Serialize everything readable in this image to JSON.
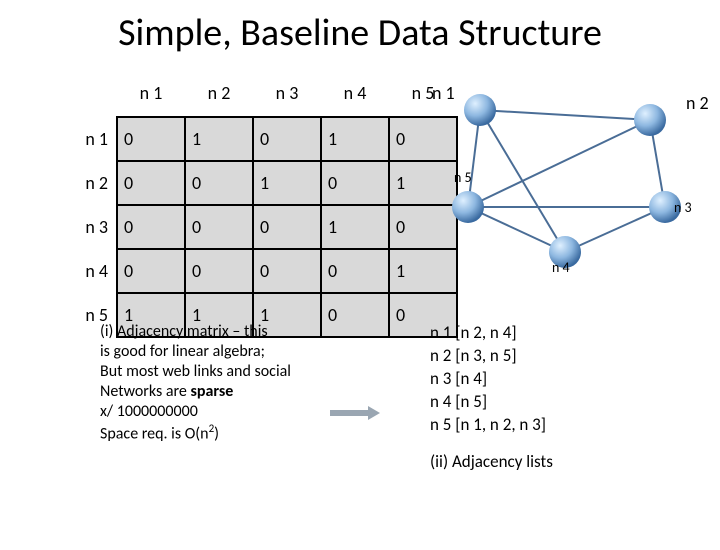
{
  "title": "Simple, Baseline Data Structure",
  "matrix": {
    "cols": [
      "n 1",
      "n 2",
      "n 3",
      "n 4",
      "n 5"
    ],
    "rows": [
      "n 1",
      "n 2",
      "n 3",
      "n 4",
      "n 5"
    ],
    "cells": [
      [
        "0",
        "1",
        "0",
        "1",
        "0"
      ],
      [
        "0",
        "0",
        "1",
        "0",
        "1"
      ],
      [
        "0",
        "0",
        "0",
        "1",
        "0"
      ],
      [
        "0",
        "0",
        "0",
        "0",
        "1"
      ],
      [
        "1",
        "1",
        "1",
        "0",
        "0"
      ]
    ]
  },
  "graph_nodes": {
    "n1": "n 1",
    "n2": "n 2",
    "n3": "n 3",
    "n4": "n 4",
    "n5": "n 5"
  },
  "caption1": {
    "l1": "(i)   Adjacency matrix – this",
    "l2": "is good for linear algebra;",
    "l3": "But most web links and social",
    "l4a": "Networks are ",
    "l4b": "sparse",
    "l5": "x/ 1000000000",
    "l6a": "Space req. is O(n",
    "l6b": "2",
    "l6c": ")"
  },
  "adjlist": {
    "r1": "n 1  [n 2, n 4]",
    "r2": "n 2 [n 3, n 5]",
    "r3": "n 3 [n 4]",
    "r4": "n 4 [n 5]",
    "r5": "n 5 [n 1, n 2, n 3]",
    "cap": "(ii) Adjacency lists"
  },
  "chart_data": {
    "type": "table",
    "title": "Adjacency matrix",
    "categories": [
      "n1",
      "n2",
      "n3",
      "n4",
      "n5"
    ],
    "series": [
      {
        "name": "n1",
        "values": [
          0,
          1,
          0,
          1,
          0
        ]
      },
      {
        "name": "n2",
        "values": [
          0,
          0,
          1,
          0,
          1
        ]
      },
      {
        "name": "n3",
        "values": [
          0,
          0,
          0,
          1,
          0
        ]
      },
      {
        "name": "n4",
        "values": [
          0,
          0,
          0,
          0,
          1
        ]
      },
      {
        "name": "n5",
        "values": [
          1,
          1,
          1,
          0,
          0
        ]
      }
    ]
  }
}
